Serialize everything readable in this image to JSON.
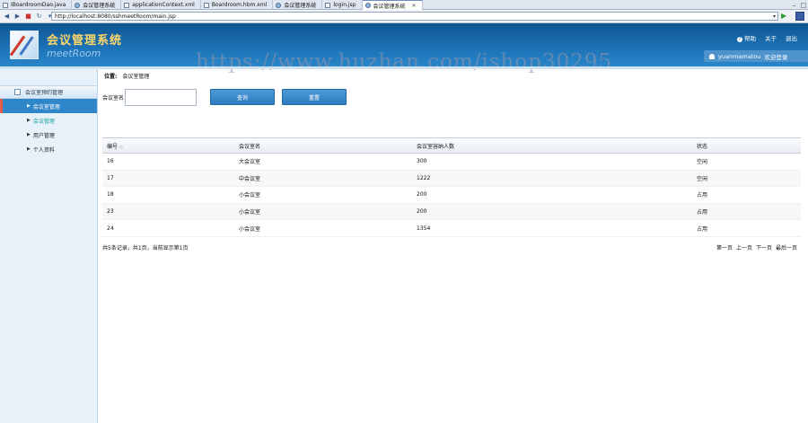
{
  "editor_tabs": [
    {
      "label": "IBoardroomDao.java",
      "icon": "java-file-icon",
      "active": false
    },
    {
      "label": "会议管理系统",
      "icon": "globe-icon",
      "active": false
    },
    {
      "label": "applicationContext.xml",
      "icon": "xml-file-icon",
      "active": false
    },
    {
      "label": "Boardroom.hbm.xml",
      "icon": "xml-file-icon",
      "active": false
    },
    {
      "label": "会议管理系统",
      "icon": "globe-icon",
      "active": false
    },
    {
      "label": "login.jsp",
      "icon": "jsp-file-icon",
      "active": false
    },
    {
      "label": "会议管理系统",
      "icon": "globe-icon",
      "active": true
    }
  ],
  "browser": {
    "url": "http://localhost:8080/sshmeetRoom/main.jsp"
  },
  "header": {
    "title": "会议管理系统",
    "subtitle": "meetRoom",
    "help": "帮助",
    "about": "关于",
    "logout": "退出",
    "username": "yuanmamatou",
    "welcome": "欢迎登录"
  },
  "watermark": "https://www.huzhan.com/ishop30295",
  "sidebar": {
    "section": "会议室预约管理",
    "items": [
      {
        "label": "会议室管理",
        "state": "active"
      },
      {
        "label": "会议管理",
        "state": "current"
      },
      {
        "label": "用户管理",
        "state": "normal"
      },
      {
        "label": "个人资料",
        "state": "normal"
      }
    ]
  },
  "main": {
    "breadcrumb_label": "位置:",
    "breadcrumb_value": "会议室管理",
    "search_label": "会议室名",
    "search_value": "",
    "query_button": "查询",
    "reset_button": "重置",
    "columns": [
      "编号",
      "会议室名",
      "会议室容纳人数",
      "状态"
    ],
    "rows": [
      {
        "id": "16",
        "name": "大会议室",
        "capacity": "300",
        "status": "空闲"
      },
      {
        "id": "17",
        "name": "中会议室",
        "capacity": "1222",
        "status": "空闲"
      },
      {
        "id": "18",
        "name": "小会议室",
        "capacity": "200",
        "status": "占用"
      },
      {
        "id": "23",
        "name": "小会议室",
        "capacity": "200",
        "status": "占用"
      },
      {
        "id": "24",
        "name": "小会议室",
        "capacity": "1354",
        "status": "占用"
      }
    ],
    "pager_info": "共5条记录，共1页，当前显示第1页",
    "pager_first": "第一页",
    "pager_prev": "上一页",
    "pager_next": "下一页",
    "pager_last": "最后一页"
  },
  "colors": {
    "header_blue": "#1d74b8",
    "title_yellow": "#ffd86a",
    "button_blue": "#2d7cc0",
    "sidebar_active": "#2f86c8"
  }
}
